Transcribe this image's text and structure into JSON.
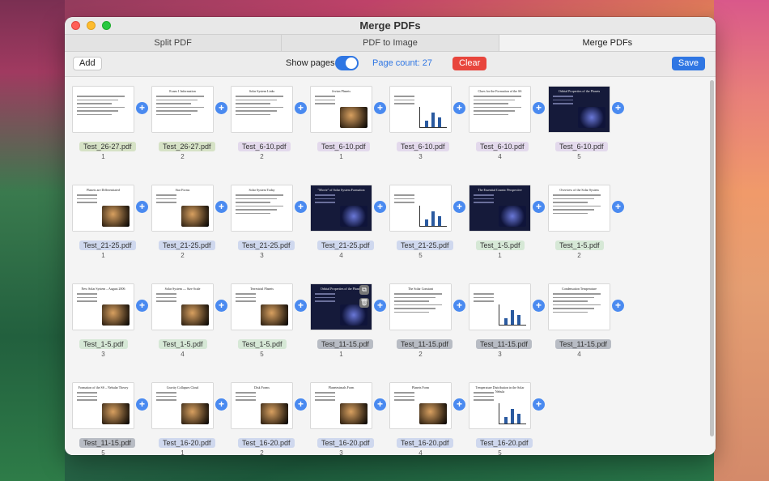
{
  "window": {
    "title": "Merge PDFs"
  },
  "tabs": [
    {
      "label": "Split PDF",
      "active": false
    },
    {
      "label": "PDF to Image",
      "active": false
    },
    {
      "label": "Merge PDFs",
      "active": true
    }
  ],
  "toolbar": {
    "add_label": "Add",
    "show_pages_label": "Show pages",
    "show_pages_on": true,
    "page_count": "Page count: 27",
    "clear_label": "Clear",
    "save_label": "Save"
  },
  "colors": {
    "accent": "#2f76e3",
    "danger": "#e8453c",
    "group_a": "#d6e2c6",
    "group_b": "#e3d9ec",
    "group_c": "#cfd8ee",
    "group_d": "#d6e8d6",
    "group_e": "#b8bcc4"
  },
  "pages": [
    {
      "file": "Test_26-27.pdf",
      "page": "1",
      "title": "",
      "group": "a",
      "style": "text"
    },
    {
      "file": "Test_26-27.pdf",
      "page": "2",
      "title": "Exam 1 Information",
      "group": "a",
      "style": "text"
    },
    {
      "file": "Test_6-10.pdf",
      "page": "2",
      "title": "Solar System Links",
      "group": "b",
      "style": "text"
    },
    {
      "file": "Test_6-10.pdf",
      "page": "1",
      "title": "Jovian Planets",
      "group": "b",
      "style": "planets"
    },
    {
      "file": "Test_6-10.pdf",
      "page": "3",
      "title": "",
      "group": "b",
      "style": "chart"
    },
    {
      "file": "Test_6-10.pdf",
      "page": "4",
      "title": "Clues for the Formation of the SS",
      "group": "b",
      "style": "text"
    },
    {
      "file": "Test_6-10.pdf",
      "page": "5",
      "title": "Orbital Properties of the Planets",
      "group": "b",
      "style": "dark"
    },
    {
      "file": "Test_21-25.pdf",
      "page": "1",
      "title": "Planets are Differentiated",
      "group": "c",
      "style": "planets"
    },
    {
      "file": "Test_21-25.pdf",
      "page": "2",
      "title": "Star Forms",
      "group": "c",
      "style": "planets"
    },
    {
      "file": "Test_21-25.pdf",
      "page": "3",
      "title": "Solar System Today",
      "group": "c",
      "style": "text"
    },
    {
      "file": "Test_21-25.pdf",
      "page": "4",
      "title": "\"Movie\" of Solar System Formation",
      "group": "c",
      "style": "dark"
    },
    {
      "file": "Test_21-25.pdf",
      "page": "5",
      "title": "",
      "group": "c",
      "style": "chart"
    },
    {
      "file": "Test_1-5.pdf",
      "page": "1",
      "title": "The Essential Cosmic Perspective",
      "group": "d",
      "style": "dark"
    },
    {
      "file": "Test_1-5.pdf",
      "page": "2",
      "title": "Overview of the Solar System",
      "group": "d",
      "style": "text"
    },
    {
      "file": "Test_1-5.pdf",
      "page": "3",
      "title": "New Solar System – August 2006",
      "group": "d",
      "style": "planets"
    },
    {
      "file": "Test_1-5.pdf",
      "page": "4",
      "title": "Solar System — Size Scale",
      "group": "d",
      "style": "planets"
    },
    {
      "file": "Test_1-5.pdf",
      "page": "5",
      "title": "Terrestrial Planets",
      "group": "d",
      "style": "planets"
    },
    {
      "file": "Test_11-15.pdf",
      "page": "1",
      "title": "Orbital Properties of the Planets",
      "group": "e",
      "style": "dark"
    },
    {
      "file": "Test_11-15.pdf",
      "page": "2",
      "title": "The Solar Constant",
      "group": "e",
      "style": "text"
    },
    {
      "file": "Test_11-15.pdf",
      "page": "3",
      "title": "",
      "group": "e",
      "style": "chart"
    },
    {
      "file": "Test_11-15.pdf",
      "page": "4",
      "title": "Condensation Temperature",
      "group": "e",
      "style": "text"
    },
    {
      "file": "Test_11-15.pdf",
      "page": "5",
      "title": "Formation of the SS – Nebular Theory",
      "group": "e",
      "style": "planets"
    },
    {
      "file": "Test_16-20.pdf",
      "page": "1",
      "title": "Gravity Collapses Cloud",
      "group": "c",
      "style": "planets"
    },
    {
      "file": "Test_16-20.pdf",
      "page": "2",
      "title": "Disk Forms",
      "group": "c",
      "style": "planets"
    },
    {
      "file": "Test_16-20.pdf",
      "page": "3",
      "title": "Planetesimals Form",
      "group": "c",
      "style": "planets"
    },
    {
      "file": "Test_16-20.pdf",
      "page": "4",
      "title": "Planets Form",
      "group": "c",
      "style": "planets"
    },
    {
      "file": "Test_16-20.pdf",
      "page": "5",
      "title": "Temperature Distribution in the Solar Nebula",
      "group": "c",
      "style": "chart"
    }
  ]
}
